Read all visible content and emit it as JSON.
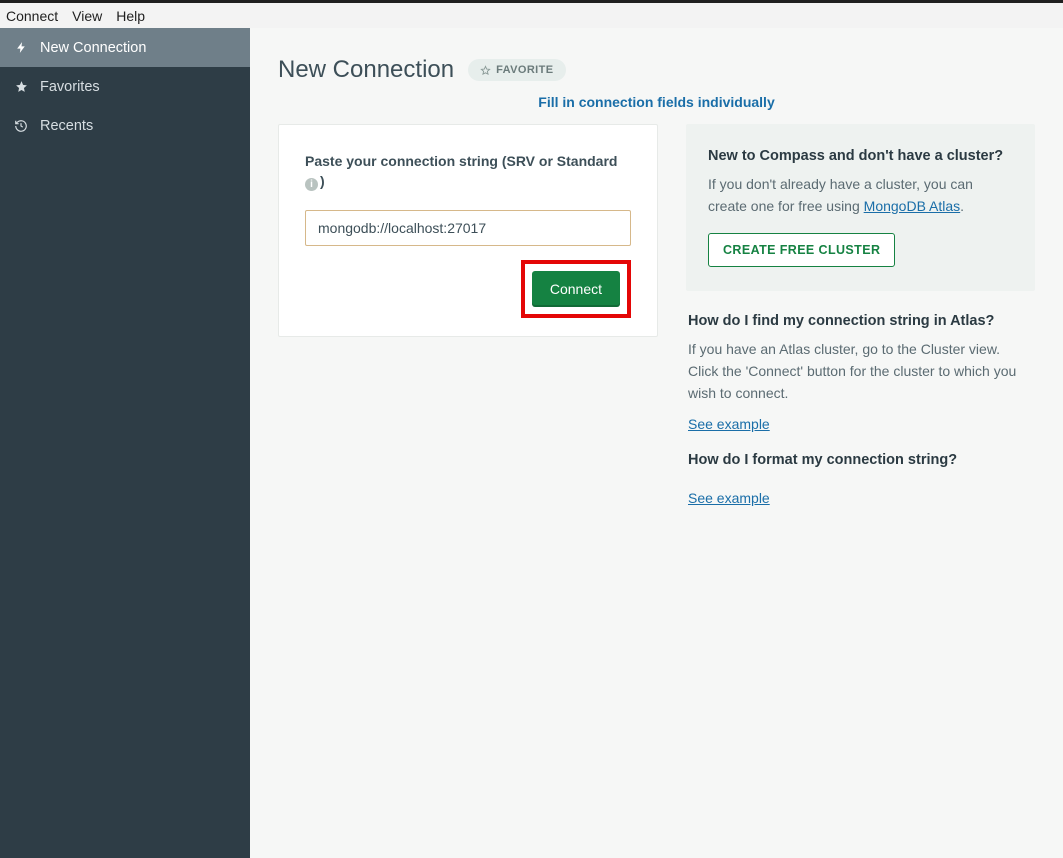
{
  "menubar": {
    "connect": "Connect",
    "view": "View",
    "help": "Help"
  },
  "sidebar": {
    "items": [
      {
        "label": "New Connection",
        "icon": "bolt-icon"
      },
      {
        "label": "Favorites",
        "icon": "star-icon"
      },
      {
        "label": "Recents",
        "icon": "history-icon"
      }
    ]
  },
  "header": {
    "title": "New Connection",
    "favorite": "FAVORITE",
    "fill_link": "Fill in connection fields individually"
  },
  "card": {
    "label": "Paste your connection string (SRV or Standard",
    "info_glyph": "i",
    "paren_close": ")",
    "input_value": "mongodb://localhost:27017",
    "connect_btn": "Connect"
  },
  "promo": {
    "heading": "New to Compass and don't have a cluster?",
    "text_pre": "If you don't already have a cluster, you can create one for free using ",
    "atlas_link": "MongoDB Atlas",
    "text_post": ".",
    "button": "CREATE FREE CLUSTER"
  },
  "faq1": {
    "heading": "How do I find my connection string in Atlas?",
    "text": "If you have an Atlas cluster, go to the Cluster view. Click the 'Connect' button for the cluster to which you wish to connect.",
    "link": "See example"
  },
  "faq2": {
    "heading": "How do I format my connection string?",
    "link": "See example"
  }
}
